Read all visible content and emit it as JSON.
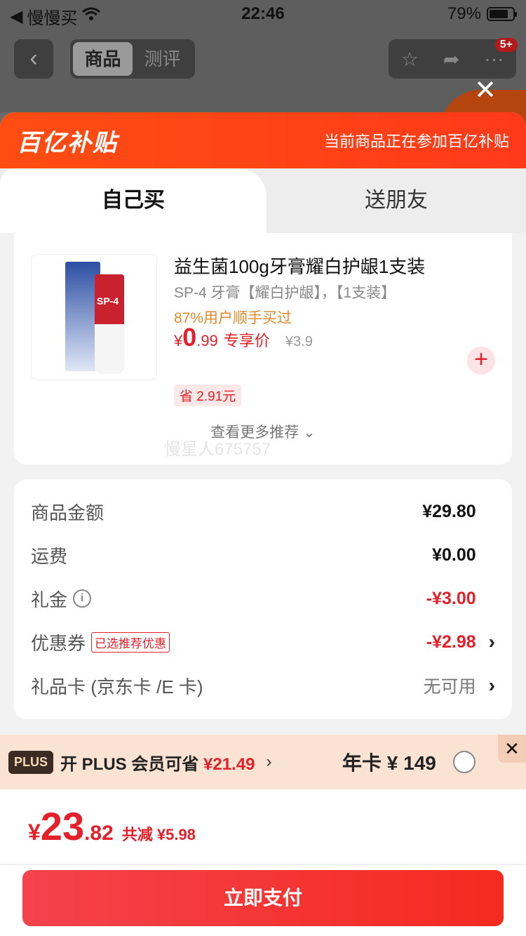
{
  "status_bar": {
    "back_app": "慢慢买",
    "time": "22:46",
    "battery": "79%"
  },
  "nav": {
    "tabs": [
      "商品",
      "测评"
    ],
    "badge": "5+"
  },
  "banner": {
    "logo": "百亿补贴",
    "note": "当前商品正在参加百亿补贴"
  },
  "mode_tabs": {
    "self": "自己买",
    "friend": "送朋友"
  },
  "product": {
    "title": "益生菌100g牙膏耀白护龈1支装",
    "subtitle": "SP-4 牙膏【耀白护龈】，【1支装】",
    "hint": "87%用户顺手买过",
    "price_yen": "¥",
    "price_int": "0",
    "price_dec": ".99",
    "price_tag": "专享价",
    "orig_price": "¥3.9",
    "save": "省 2.91元",
    "image_label": "SP-4",
    "more": "查看更多推荐",
    "watermark": "慢星人675757"
  },
  "summary": {
    "goods_label": "商品金额",
    "goods_value": "¥29.80",
    "shipping_label": "运费",
    "shipping_value": "¥0.00",
    "gift_label": "礼金",
    "gift_value": "-¥3.00",
    "coupon_label": "优惠券",
    "coupon_tag": "已选推荐优惠",
    "coupon_value": "-¥2.98",
    "card_label": "礼品卡 (京东卡 /E 卡)",
    "card_value": "无可用"
  },
  "plus": {
    "logo": "PLUS",
    "text_prefix": "开 PLUS 会员可省",
    "save": "¥21.49",
    "year": "年卡 ¥ 149"
  },
  "footer": {
    "yen": "¥",
    "total_int": "23",
    "total_dec": ".82",
    "reduce": "共减 ¥5.98",
    "pay": "立即支付"
  },
  "colors": {
    "accent": "#e4202a",
    "banner": "#ff4d12"
  }
}
